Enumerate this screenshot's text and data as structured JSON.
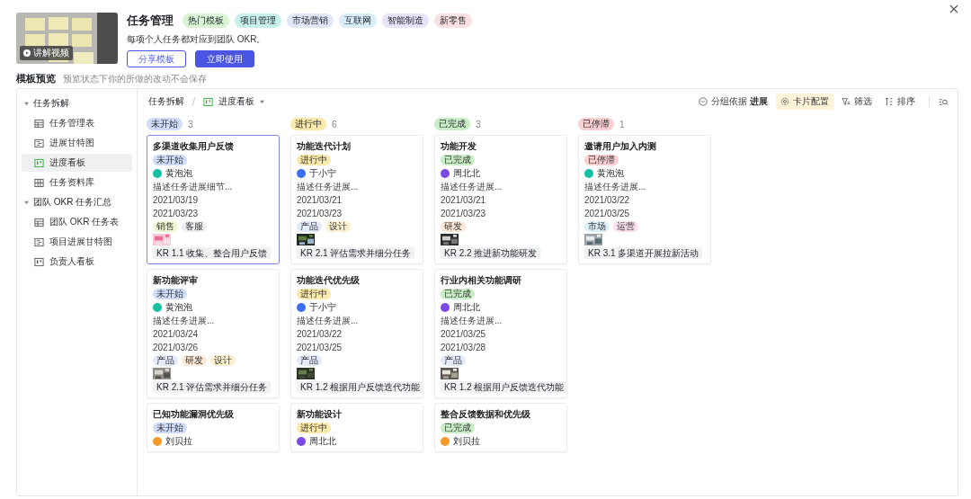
{
  "template": {
    "title": "任务管理",
    "video_label": "讲解视频",
    "description": "每项个人任务都对应到团队 OKR。",
    "tags": [
      {
        "label": "热门模板",
        "color": "#d9f5d6"
      },
      {
        "label": "项目管理",
        "color": "#c9f1ec"
      },
      {
        "label": "市场营销",
        "color": "#e0e8f7"
      },
      {
        "label": "互联网",
        "color": "#d9eefa"
      },
      {
        "label": "智能制造",
        "color": "#e8e3fa"
      },
      {
        "label": "新零售",
        "color": "#fbe1e1"
      }
    ],
    "buttons": [
      {
        "label": "分享模板",
        "kind": "secondary"
      },
      {
        "label": "立即使用",
        "kind": "primary"
      }
    ]
  },
  "preview": {
    "title": "模板预览",
    "hint": "预览状态下你的所做的改动不会保存"
  },
  "sidebar": {
    "groups": [
      {
        "label": "任务拆解",
        "expanded": true,
        "children": [
          {
            "label": "任务管理表",
            "kind": "table",
            "selected": false
          },
          {
            "label": "进展甘特图",
            "kind": "gantt",
            "selected": false
          },
          {
            "label": "进度看板",
            "kind": "board",
            "selected": true
          },
          {
            "label": "任务资料库",
            "kind": "gallery",
            "selected": false
          }
        ]
      },
      {
        "label": "团队 OKR 任务汇总",
        "expanded": true,
        "children": [
          {
            "label": "团队 OKR 任务表",
            "kind": "table",
            "selected": false
          },
          {
            "label": "项目进展甘特图",
            "kind": "gantt",
            "selected": false
          },
          {
            "label": "负责人看板",
            "kind": "board",
            "selected": false
          }
        ]
      }
    ]
  },
  "breadcrumb": {
    "parent": "任务拆解",
    "current": "进度看板"
  },
  "toolbar": [
    {
      "label": "分组依据 **进展**",
      "kind": "group",
      "selected": false
    },
    {
      "label": "卡片配置",
      "kind": "settings",
      "selected": true
    },
    {
      "label": "筛选",
      "kind": "filter",
      "selected": false
    },
    {
      "label": "排序",
      "kind": "sort",
      "selected": false
    }
  ],
  "columns": [
    {
      "status": "未开始",
      "count": "3",
      "color": "#cfdcf9",
      "cards": [
        {
          "title": "多渠道收集用户反馈",
          "selected": true,
          "status": {
            "label": "未开始",
            "color": "#cfdcf9"
          },
          "assignee": "黄泡泡",
          "avatar": {
            "color": "#14c1a2"
          },
          "description": "描述任务进展细节...",
          "start": "2021/03/19",
          "end": "2021/03/23",
          "tags": [
            {
              "label": "销售",
              "color": "#eef6d2"
            },
            {
              "label": "客服",
              "color": "#eceef1"
            }
          ],
          "picture": true,
          "kr": "KR 1.1 收集、整合用户反馈"
        },
        {
          "title": "新功能评审",
          "selected": false,
          "status": {
            "label": "未开始",
            "color": "#cfdcf9"
          },
          "assignee": "黄泡泡",
          "avatar": {
            "color": "#14c1a2"
          },
          "description": "描述任务进展...",
          "start": "2021/03/24",
          "end": "2021/03/26",
          "tags": [
            {
              "label": "产品",
              "color": "#e3ebfa"
            },
            {
              "label": "研发",
              "color": "#fbe8d7"
            },
            {
              "label": "设计",
              "color": "#fbf0cf"
            }
          ],
          "picture": true,
          "kr": "KR 2.1 评估需求并细分任务"
        },
        {
          "title": "已知功能漏洞优先级",
          "selected": false,
          "status": {
            "label": "未开始",
            "color": "#cfdcf9"
          },
          "assignee": "刘贝拉",
          "avatar": {
            "color": "#f39a2b"
          }
        }
      ]
    },
    {
      "status": "进行中",
      "count": "6",
      "color": "#fbe9a9",
      "cards": [
        {
          "title": "功能迭代计划",
          "selected": false,
          "status": {
            "label": "进行中",
            "color": "#fbe9a9"
          },
          "assignee": "于小宁",
          "avatar": {
            "color": "#3d6ef0"
          },
          "description": "描述任务进展...",
          "start": "2021/03/21",
          "end": "2021/03/23",
          "tags": [
            {
              "label": "产品",
              "color": "#e3ebfa"
            },
            {
              "label": "设计",
              "color": "#fbf0cf"
            }
          ],
          "picture": true,
          "kr": "KR 2.1 评估需求并细分任务"
        },
        {
          "title": "功能迭代优先级",
          "selected": false,
          "status": {
            "label": "进行中",
            "color": "#fbe9a9"
          },
          "assignee": "于小宁",
          "avatar": {
            "color": "#3d6ef0"
          },
          "description": "描述任务进展...",
          "start": "2021/03/22",
          "end": "2021/03/25",
          "tags": [
            {
              "label": "产品",
              "color": "#e3ebfa"
            }
          ],
          "picture": true,
          "kr": "KR 1.2 根据用户反馈迭代功能"
        },
        {
          "title": "新功能设计",
          "selected": false,
          "status": {
            "label": "进行中",
            "color": "#fbe9a9"
          },
          "assignee": "周北北",
          "avatar": {
            "color": "#7b4ae6"
          }
        }
      ]
    },
    {
      "status": "已完成",
      "count": "3",
      "color": "#c9edc4",
      "cards": [
        {
          "title": "功能开发",
          "selected": false,
          "status": {
            "label": "已完成",
            "color": "#c9edc4"
          },
          "assignee": "周北北",
          "avatar": {
            "color": "#7b4ae6"
          },
          "description": "描述任务进展...",
          "start": "2021/03/21",
          "end": "2021/03/23",
          "tags": [
            {
              "label": "研发",
              "color": "#fbe8d7"
            }
          ],
          "picture": true,
          "kr": "KR 2.2 推进新功能研发"
        },
        {
          "title": "行业内相关功能调研",
          "selected": false,
          "status": {
            "label": "已完成",
            "color": "#c9edc4"
          },
          "assignee": "周北北",
          "avatar": {
            "color": "#7b4ae6"
          },
          "description": "描述任务进展...",
          "start": "2021/03/25",
          "end": "2021/03/28",
          "tags": [
            {
              "label": "产品",
              "color": "#e3ebfa"
            }
          ],
          "picture": true,
          "kr": "KR 1.2 根据用户反馈迭代功能"
        },
        {
          "title": "整合反馈数据和优先级",
          "selected": false,
          "status": {
            "label": "已完成",
            "color": "#c9edc4"
          },
          "assignee": "刘贝拉",
          "avatar": {
            "color": "#f39a2b"
          }
        }
      ]
    },
    {
      "status": "已停滞",
      "count": "1",
      "color": "#f9cfcf",
      "cards": [
        {
          "title": "邀请用户加入内测",
          "selected": false,
          "status": {
            "label": "已停滞",
            "color": "#f9cfcf"
          },
          "assignee": "黄泡泡",
          "avatar": {
            "color": "#14c1a2"
          },
          "description": "描述任务进展...",
          "start": "2021/03/22",
          "end": "2021/03/25",
          "tags": [
            {
              "label": "市场",
              "color": "#dcf0fa"
            },
            {
              "label": "运营",
              "color": "#fbe0ef"
            }
          ],
          "picture": true,
          "kr": "KR 3.1 多渠道开展拉新活动"
        }
      ]
    }
  ]
}
